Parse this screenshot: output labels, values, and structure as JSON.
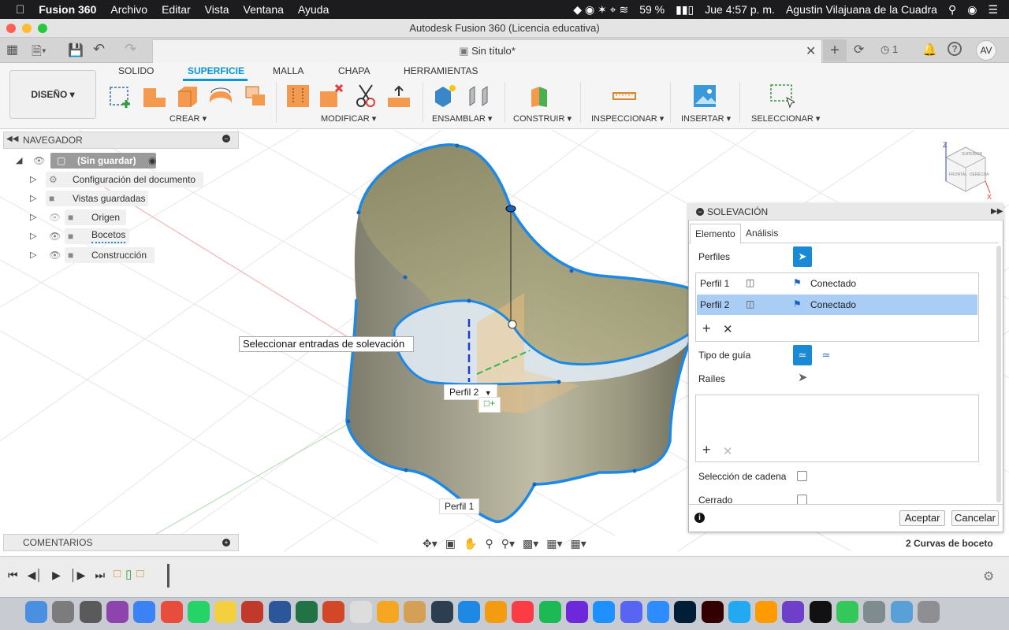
{
  "menubar": {
    "app_name": "Fusion 360",
    "menus": [
      "Archivo",
      "Editar",
      "Vista",
      "Ventana",
      "Ayuda"
    ],
    "battery": "59 %",
    "datetime": "Jue 4:57 p. m.",
    "user": "Agustin Vilajuana de la Cuadra"
  },
  "window": {
    "title": "Autodesk Fusion 360 (Licencia educativa)"
  },
  "document_tab": {
    "title": "Sin título*"
  },
  "app_toolbar": {
    "jobs_count": "1",
    "avatar": "AV"
  },
  "ribbon": {
    "workspace": "DISEÑO",
    "tabs": [
      "SOLIDO",
      "SUPERFICIE",
      "MALLA",
      "CHAPA",
      "HERRAMIENTAS"
    ],
    "groups": [
      "CREAR",
      "MODIFICAR",
      "ENSAMBLAR",
      "CONSTRUIR",
      "INSPECCIONAR",
      "INSERTAR",
      "SELECCIONAR"
    ]
  },
  "navigator": {
    "title": "NAVEGADOR",
    "root": "(Sin guardar)",
    "items": [
      "Configuración del documento",
      "Vistas guardadas",
      "Origen",
      "Bocetos",
      "Construcción"
    ]
  },
  "comments": {
    "title": "COMENTARIOS"
  },
  "viewport": {
    "tooltip": "Seleccionar entradas de solevación",
    "label_perfil2": "Perfil 2",
    "label_perfil1": "Perfil 1"
  },
  "viewcube": {
    "axis_z": "Z",
    "axis_x": "X"
  },
  "loft_panel": {
    "title": "SOLEVACIÓN",
    "tabs": [
      "Elemento",
      "Análisis"
    ],
    "perfiles_label": "Perfiles",
    "profiles": [
      {
        "name": "Perfil 1",
        "status": "Conectado"
      },
      {
        "name": "Perfil 2",
        "status": "Conectado"
      }
    ],
    "guide_type_label": "Tipo de guía",
    "rails_label": "Raíles",
    "chain_label": "Selección de cadena",
    "closed_label": "Cerrado",
    "ok_label": "Aceptar",
    "cancel_label": "Cancelar"
  },
  "status": {
    "selection": "2 Curvas de boceto"
  },
  "colors": {
    "accent": "#0696d7",
    "selection_blue": "#1e88e5",
    "row_selected": "#a9cdf5",
    "surface_olive": "#8f8d6d"
  }
}
